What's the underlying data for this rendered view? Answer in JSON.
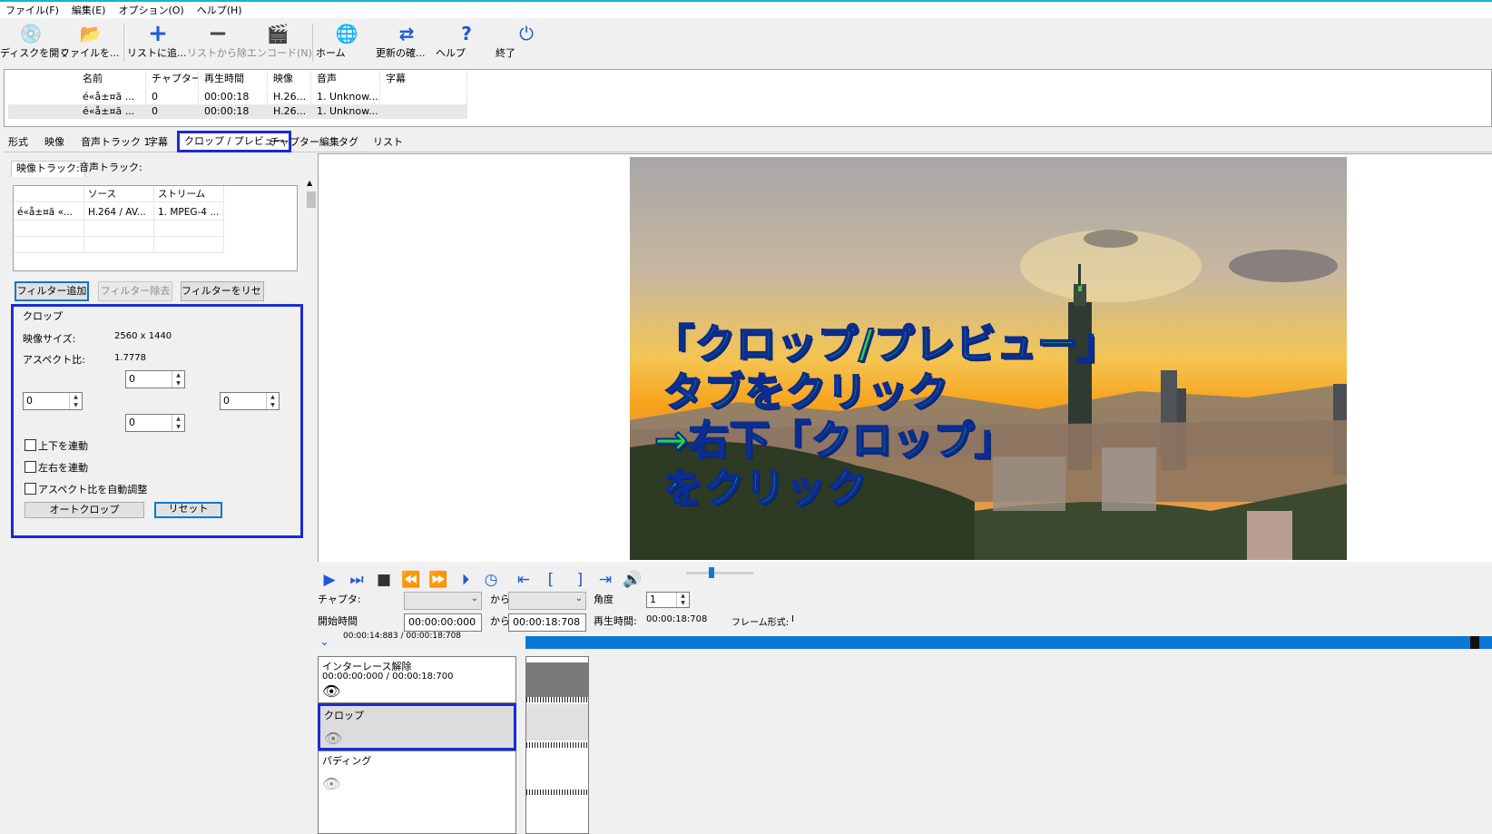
{
  "menu": [
    "ファイル(F)",
    "編集(E)",
    "オプション(O)",
    "ヘルプ(H)"
  ],
  "toolbar": {
    "open_disc": "ディスクを開く",
    "open_file": "ファイルを...",
    "add_list": "リストに追...",
    "remove_list": "リストから除...",
    "encode": "エンコード(N)",
    "home": "ホーム",
    "update": "更新の確...",
    "help": "ヘルプ",
    "exit": "終了"
  },
  "file_list": {
    "headers": [
      "名前",
      "チャプター",
      "再生時間",
      "映像",
      "音声",
      "字幕"
    ],
    "rows": [
      [
        "é«å±¤ã ...",
        "0",
        "00:00:18",
        "H.26...",
        "1. Unknow...",
        ""
      ],
      [
        "é«å±¤ã ...",
        "0",
        "00:00:18",
        "H.26...",
        "1. Unknow...",
        ""
      ]
    ]
  },
  "tabs": [
    "形式",
    "映像",
    "音声トラック 1",
    "字幕",
    "クロップ / プレビュー",
    "チャプター編集",
    "タグ",
    "リスト"
  ],
  "sub_tabs": [
    "映像トラック:",
    "音声トラック:"
  ],
  "track_table": {
    "headers": [
      "",
      "ソース",
      "ストリーム"
    ],
    "row": [
      "é«å±¤ã «...",
      "H.264 / AV...",
      "1. MPEG-4 ..."
    ]
  },
  "filter_buttons": {
    "add": "フィルター追加",
    "remove": "フィルター除去",
    "reset": "フィルターをリセット"
  },
  "crop": {
    "title": "クロップ",
    "video_size_label": "映像サイズ:",
    "video_size": "2560 x 1440",
    "aspect_label": "アスペクト比:",
    "aspect": "1.7778",
    "top": "0",
    "left": "0",
    "right": "0",
    "bottom": "0",
    "link_tb": "上下を連動",
    "link_lr": "左右を連動",
    "auto_aspect": "アスペクト比を自動調整",
    "autocrop": "オートクロップ",
    "reset": "リセット"
  },
  "annotation": {
    "line1": "「クロップ/プレビュー」",
    "line2": "タブをクリック",
    "line3": "→右下「クロップ」",
    "line4": "をクリック"
  },
  "controls": {
    "chapter_label": "チャプタ:",
    "from_label": "から",
    "angle_label": "角度",
    "angle": "1",
    "start_label": "開始時間",
    "start": "00:00:00:000",
    "from_label2": "から",
    "end": "00:00:18:708",
    "duration_label": "再生時間:",
    "duration": "00:00:18:708",
    "frame_label": "フレーム形式:",
    "frame": "I",
    "position": "00:00:14:883 / 00:00:18:708",
    "playhead": 0.98
  },
  "filters": [
    {
      "name": "インターレース解除",
      "time": "00:00:00:000 / 00:00:18:700"
    },
    {
      "name": "クロップ",
      "time": ""
    },
    {
      "name": "パディング",
      "time": ""
    }
  ],
  "colors": {
    "highlight": "#1a2bd6",
    "annotation": "#27d73a",
    "timeline": "#0b78d7"
  }
}
